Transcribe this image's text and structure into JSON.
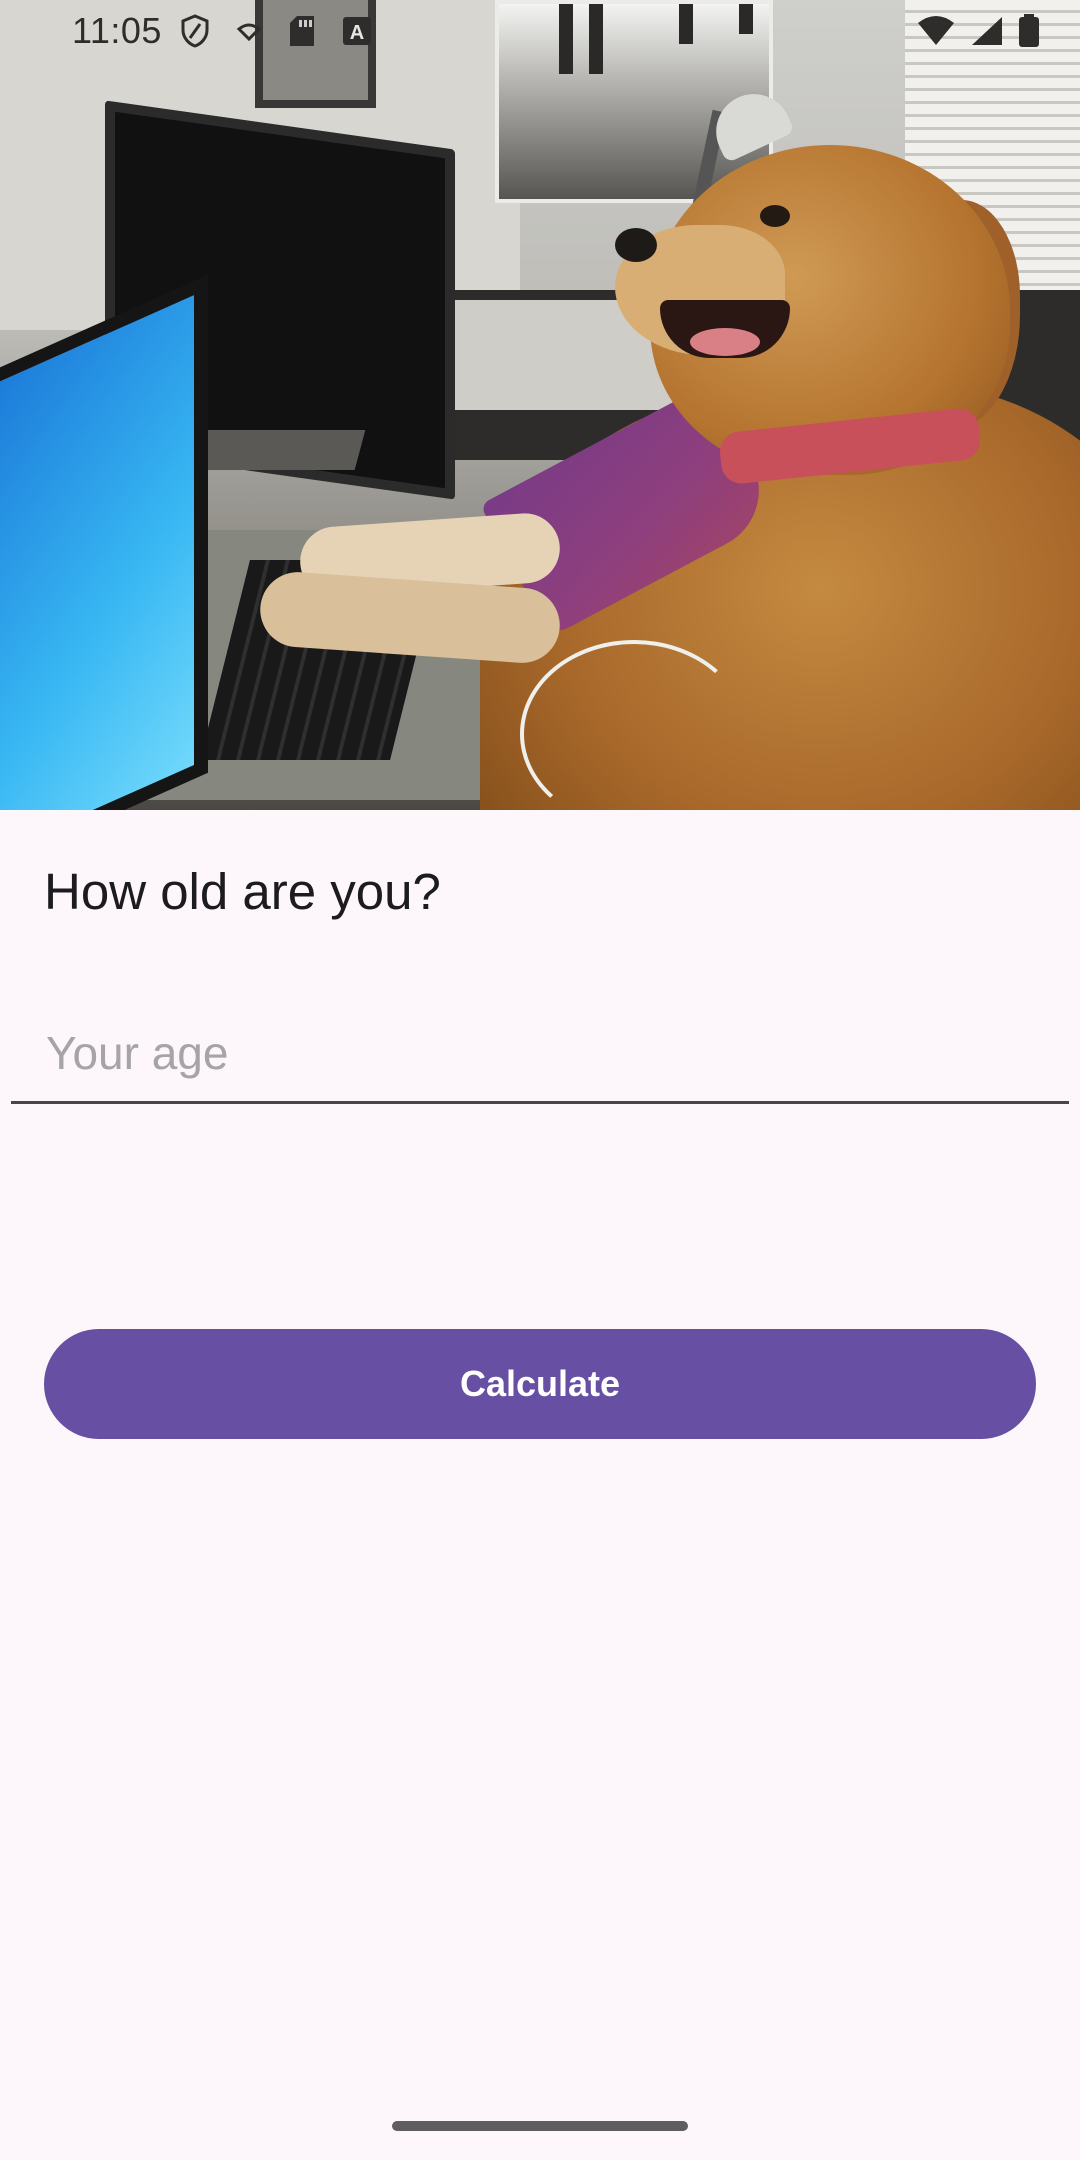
{
  "status_bar": {
    "time": "11:05",
    "left_icons": [
      "shield-icon",
      "nfc-icon",
      "sd-card-icon",
      "a-badge-icon"
    ],
    "right_icons": [
      "wifi-icon",
      "cell-signal-icon",
      "battery-icon"
    ]
  },
  "header_image": {
    "description_icon": "dog-at-computer-photo"
  },
  "form": {
    "question": "How old are you?",
    "age_placeholder": "Your age",
    "age_value": ""
  },
  "actions": {
    "calculate_label": "Calculate"
  },
  "colors": {
    "background": "#fdf7fc",
    "primary": "#6750a4",
    "on_primary": "#ffffff",
    "text": "#1c1b1f",
    "placeholder": "#a6a4a8",
    "underline": "#49454f"
  }
}
